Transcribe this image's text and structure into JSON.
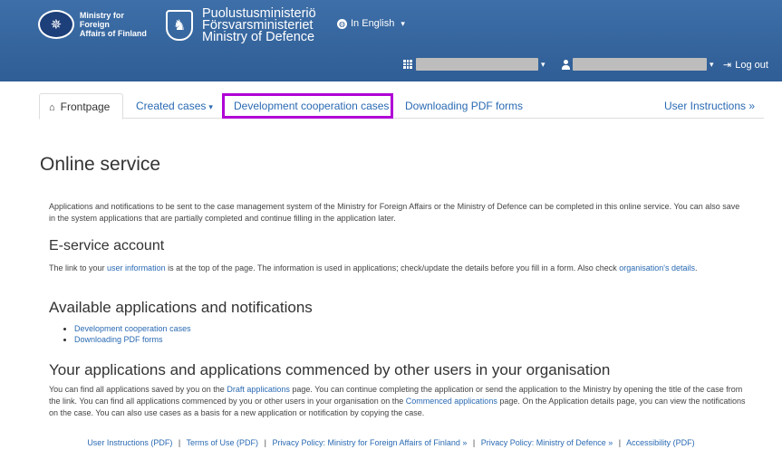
{
  "header": {
    "mfa_line1": "Ministry for Foreign",
    "mfa_line2": "Affairs of Finland",
    "mod_line1": "Puolustusministeriö",
    "mod_line2": "Försvarsministeriet",
    "mod_line3": "Ministry of Defence",
    "language": "In English",
    "logout": "Log out"
  },
  "nav": {
    "tabs": [
      {
        "label": "Frontpage"
      },
      {
        "label": "Created cases"
      },
      {
        "label": "Development cooperation cases"
      },
      {
        "label": "Downloading PDF forms"
      },
      {
        "label": "User Instructions »"
      }
    ]
  },
  "main": {
    "title": "Online service",
    "intro": "Applications and notifications to be sent to the case management system of the Ministry for Foreign Affairs or the Ministry of Defence can be completed in this online service. You can also save in the system applications that are partially completed and continue filling in the application later.",
    "account_heading": "E-service account",
    "account_text_1": "The link to your",
    "account_link_1": "user information",
    "account_text_2": "is at the top of the page. The information is used in applications; check/update the details before you fill in a form. Also check",
    "account_link_2": "organisation's details",
    "available_heading": "Available applications and notifications",
    "available_items": [
      "Development cooperation cases",
      "Downloading PDF forms"
    ],
    "your_heading": "Your applications and applications commenced by other users in your organisation",
    "your_text_1": "You can find all applications saved by you on the",
    "your_link_1": "Draft applications",
    "your_text_2": "page. You can continue completing the application or send the application to the Ministry by opening the title of the case from the link. You can find all applications commenced by you or other users in your organisation on the",
    "your_link_2": "Commenced applications",
    "your_text_3": "page. On the Application details page, you can view the notifications on the case. You can also use cases as a basis for a new application or notification by copying the case."
  },
  "footer": {
    "links": [
      "User Instructions (PDF)",
      "Terms of Use (PDF)",
      "Privacy Policy: Ministry for Foreign Affairs of Finland »",
      "Privacy Policy: Ministry of Defence »",
      "Accessibility (PDF)"
    ],
    "separator": "|"
  }
}
